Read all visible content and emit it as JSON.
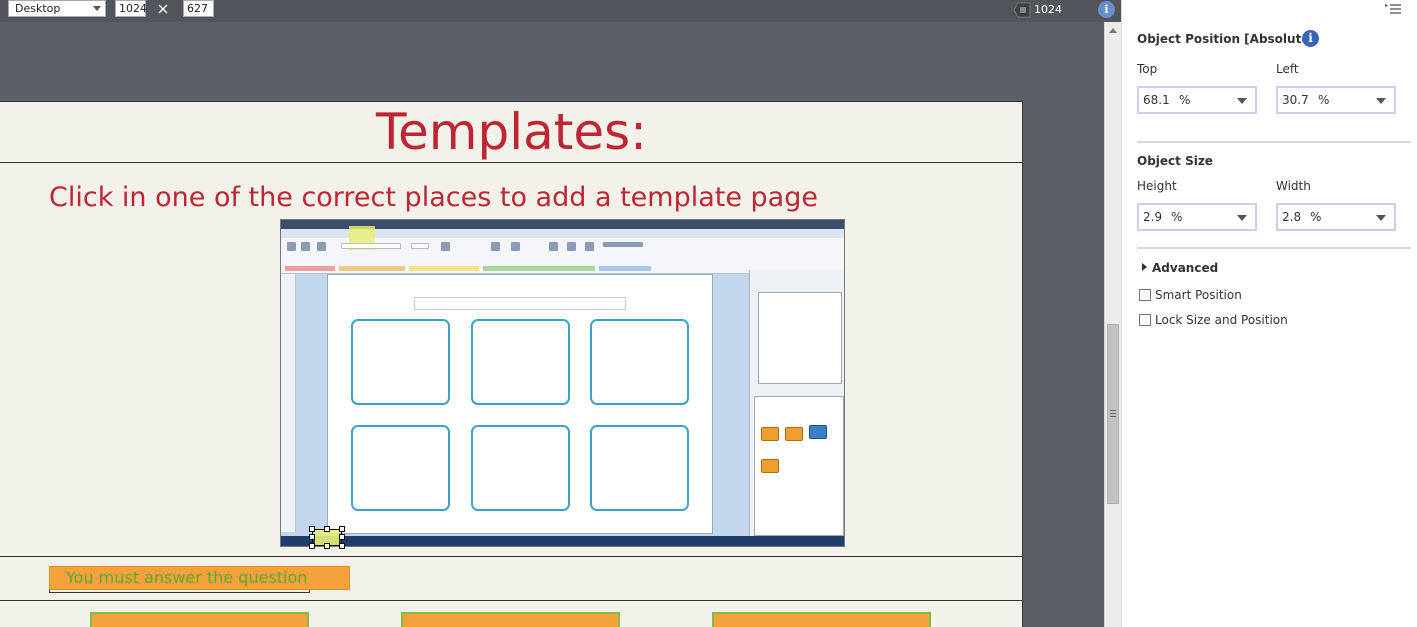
{
  "toolbar": {
    "device": "Desktop",
    "width": "1024",
    "height": "627",
    "ruler_value": "1024",
    "info_icon": "i"
  },
  "slide": {
    "title": "Templates:",
    "subtitle": "Click in one of the correct places to add a template page",
    "feedback_caption": "You must answer the question"
  },
  "properties": {
    "position_title": "Object Position [Absolute]",
    "info_icon": "i",
    "top_label": "Top",
    "top_value": "68.1",
    "top_unit": "%",
    "left_label": "Left",
    "left_value": "30.7",
    "left_unit": "%",
    "size_title": "Object Size",
    "height_label": "Height",
    "height_value": "2.9",
    "height_unit": "%",
    "width_label": "Width",
    "width_value": "2.8",
    "width_unit": "%",
    "advanced_label": "Advanced",
    "smart_position_label": "Smart Position",
    "lock_label": "Lock Size and Position"
  },
  "colors": {
    "title_red": "#be2633",
    "caption_orange": "#f6a23c",
    "caption_text_green": "#5aa832",
    "field_border": "#d8c8ee",
    "template_cell_blue": "#3aa3c9"
  }
}
